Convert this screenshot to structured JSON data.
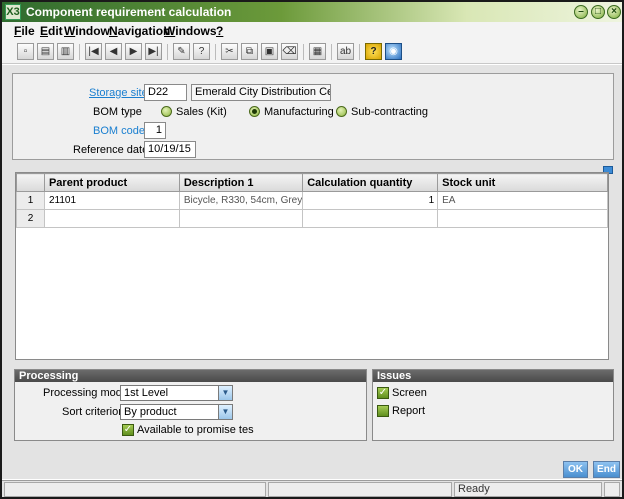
{
  "window": {
    "title": "Component requirement calculation",
    "app_icon": "X3"
  },
  "menu": [
    {
      "pre": "",
      "u": "F",
      "post": "ile"
    },
    {
      "pre": "",
      "u": "E",
      "post": "dit"
    },
    {
      "pre": "",
      "u": "W",
      "post": "indow"
    },
    {
      "pre": "",
      "u": "N",
      "post": "avigation"
    },
    {
      "pre": "",
      "u": "W",
      "post": "indows"
    },
    {
      "pre": "",
      "u": "?",
      "post": ""
    }
  ],
  "form": {
    "storage_site_label": "Storage site",
    "storage_site_code": "D22",
    "storage_site_name": "Emerald City Distribution Center",
    "bom_type_label": "BOM type",
    "bom_type_options": [
      "Sales (Kit)",
      "Manufacturing",
      "Sub-contracting"
    ],
    "bom_type_selected": "Manufacturing",
    "bom_code_label": "BOM code",
    "bom_code_value": "1",
    "reference_date_label": "Reference date",
    "reference_date_value": "10/19/15"
  },
  "grid": {
    "columns": [
      "Parent product",
      "Description 1",
      "Calculation quantity",
      "Stock unit"
    ],
    "rows": [
      {
        "num": "1",
        "parent": "21101",
        "description": "Bicycle, R330, 54cm, Grey",
        "qty": "1",
        "unit": "EA"
      },
      {
        "num": "2",
        "parent": "",
        "description": "",
        "qty": "",
        "unit": ""
      }
    ]
  },
  "processing": {
    "header": "Processing",
    "mode_label": "Processing mode",
    "mode_value": "1st Level",
    "sort_label": "Sort criterion",
    "sort_value": "By product",
    "atp_label": "Available to promise tes"
  },
  "issues": {
    "header": "Issues",
    "screen_label": "Screen",
    "report_label": "Report"
  },
  "buttons": {
    "ok": "OK",
    "end": "End"
  },
  "status": {
    "ready": "Ready"
  }
}
